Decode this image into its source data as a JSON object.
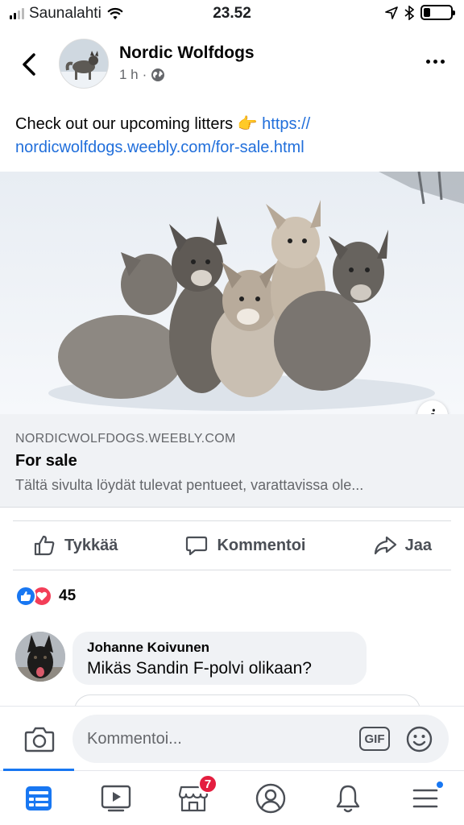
{
  "status_bar": {
    "carrier": "Saunalahti",
    "time": "23.52",
    "battery_level": 0.25
  },
  "header": {
    "page_name": "Nordic Wolfdogs",
    "post_time": "1 h",
    "separator": "·",
    "audience_icon": "globe-icon"
  },
  "post": {
    "text": "Check out our upcoming litters",
    "emoji": "👉",
    "link_line1": "https://",
    "link_line2": "nordicwolfdogs.weebly.com/for-sale.html"
  },
  "link_preview": {
    "domain": "NORDICWOLFDOGS.WEEBLY.COM",
    "title": "For sale",
    "description": "Tältä sivulta löydät tulevat pentueet, varattavissa ole...",
    "info_label": "i"
  },
  "actions": {
    "like": "Tykkää",
    "comment": "Kommentoi",
    "share": "Jaa"
  },
  "reactions": {
    "count": "45",
    "types": [
      "like",
      "love"
    ]
  },
  "comment": {
    "author": "Johanne Koivunen",
    "text": "Mikäs Sandin F-polvi olikaan?"
  },
  "composer": {
    "placeholder": "Kommentoi...",
    "gif_label": "GIF"
  },
  "tab_bar": {
    "marketplace_badge": "7",
    "tabs": [
      "news-feed-icon",
      "watch-icon",
      "marketplace-icon",
      "profile-icon",
      "notifications-icon",
      "menu-icon"
    ]
  },
  "colors": {
    "link": "#216fdb",
    "accent": "#1877f2",
    "love": "#f33e58",
    "badge": "#e41e3f"
  }
}
